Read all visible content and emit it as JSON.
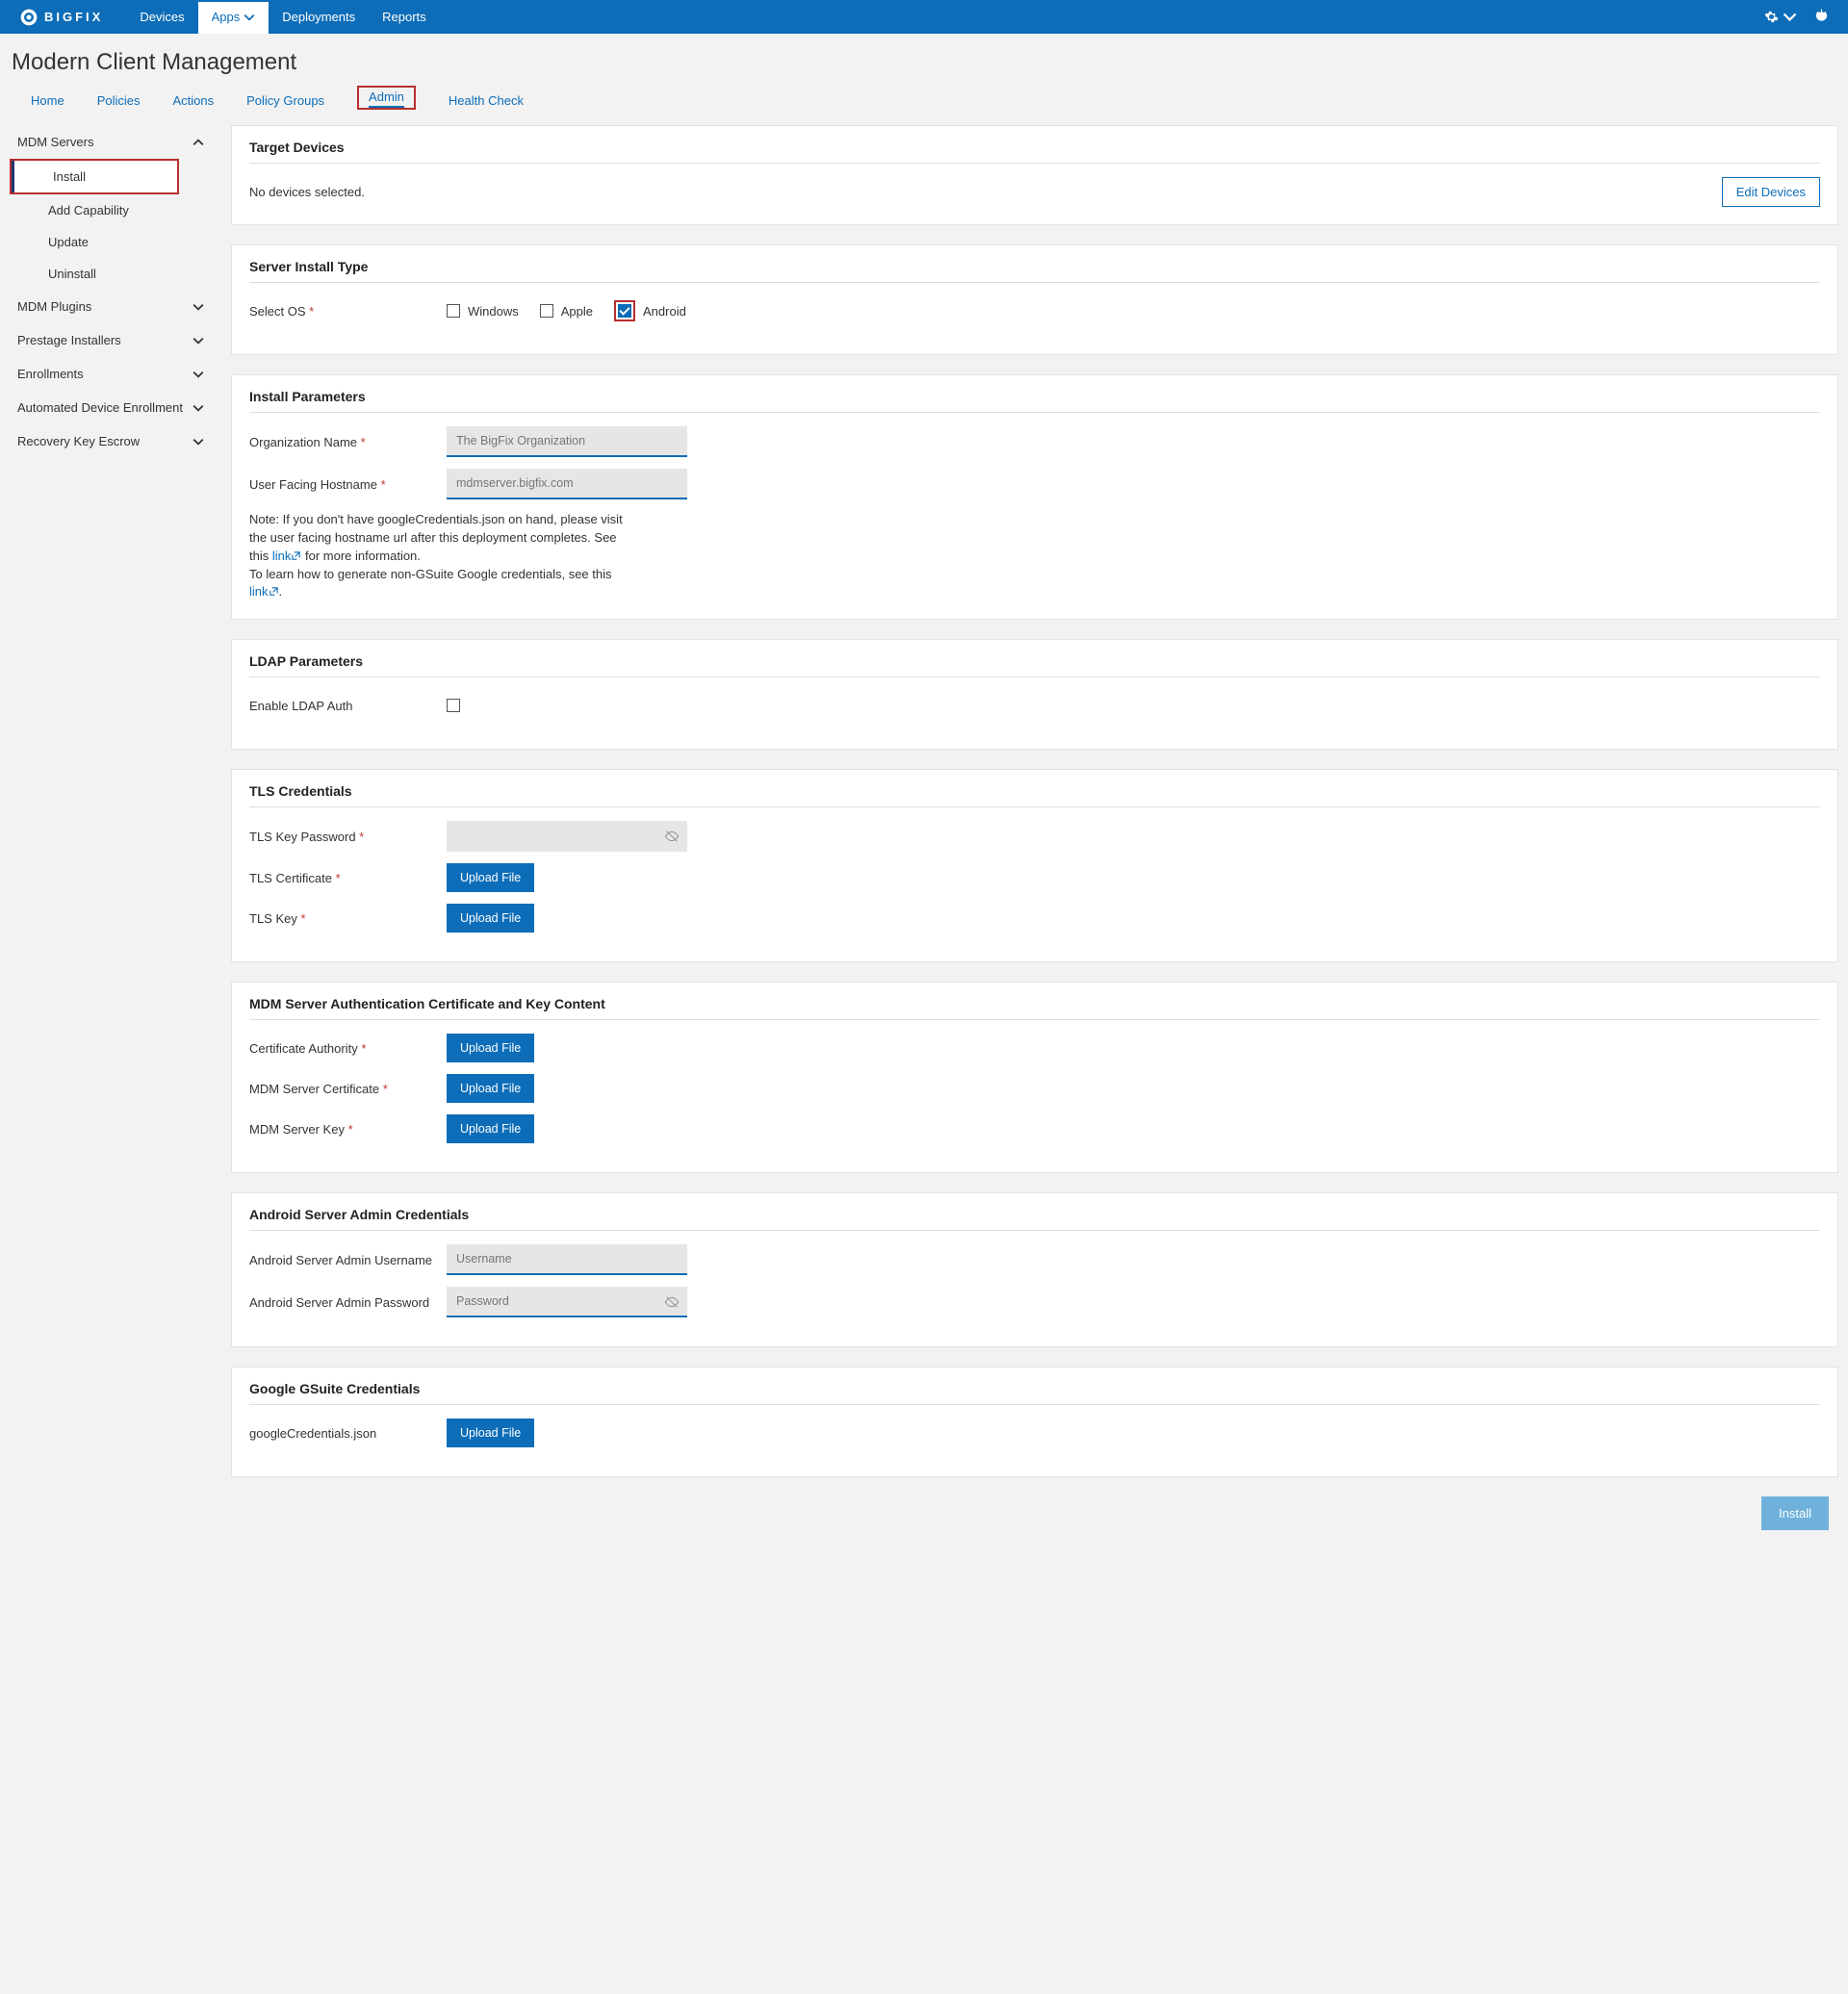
{
  "brand": "BIGFIX",
  "topnav": {
    "devices": "Devices",
    "apps": "Apps",
    "deployments": "Deployments",
    "reports": "Reports"
  },
  "page_title": "Modern Client Management",
  "subtabs": {
    "home": "Home",
    "policies": "Policies",
    "actions": "Actions",
    "policy_groups": "Policy Groups",
    "admin": "Admin",
    "health": "Health Check"
  },
  "sidebar": {
    "mdm_servers": "MDM Servers",
    "install": "Install",
    "add_capability": "Add Capability",
    "update": "Update",
    "uninstall": "Uninstall",
    "mdm_plugins": "MDM Plugins",
    "prestage": "Prestage Installers",
    "enrollments": "Enrollments",
    "auto_enroll": "Automated Device Enrollment",
    "recovery": "Recovery Key Escrow"
  },
  "target": {
    "title": "Target Devices",
    "none": "No devices selected.",
    "edit": "Edit Devices"
  },
  "server_type": {
    "title": "Server Install Type",
    "select_os": "Select OS",
    "windows": "Windows",
    "apple": "Apple",
    "android": "Android"
  },
  "install_params": {
    "title": "Install Parameters",
    "org_label": "Organization Name",
    "org_ph": "The BigFix Organization",
    "host_label": "User Facing Hostname",
    "host_ph": "mdmserver.bigfix.com",
    "note1": "Note: If you don't have googleCredentials.json on hand, please visit the user facing hostname url after this deployment completes. See this ",
    "link": "link",
    "note1b": " for more information.",
    "note2": "To learn how to generate non-GSuite Google credentials, see this "
  },
  "ldap": {
    "title": "LDAP Parameters",
    "enable": "Enable LDAP Auth"
  },
  "tls": {
    "title": "TLS Credentials",
    "pwd": "TLS Key Password",
    "cert": "TLS Certificate",
    "key": "TLS Key"
  },
  "mdm_auth": {
    "title": "MDM Server Authentication Certificate and Key Content",
    "ca": "Certificate Authority",
    "cert": "MDM Server Certificate",
    "key": "MDM Server Key"
  },
  "android_cred": {
    "title": "Android Server Admin Credentials",
    "user": "Android Server Admin Username",
    "user_ph": "Username",
    "pwd": "Android Server Admin Password",
    "pwd_ph": "Password"
  },
  "gsuite": {
    "title": "Google GSuite Credentials",
    "file": "googleCredentials.json"
  },
  "buttons": {
    "upload": "Upload File",
    "install": "Install"
  }
}
